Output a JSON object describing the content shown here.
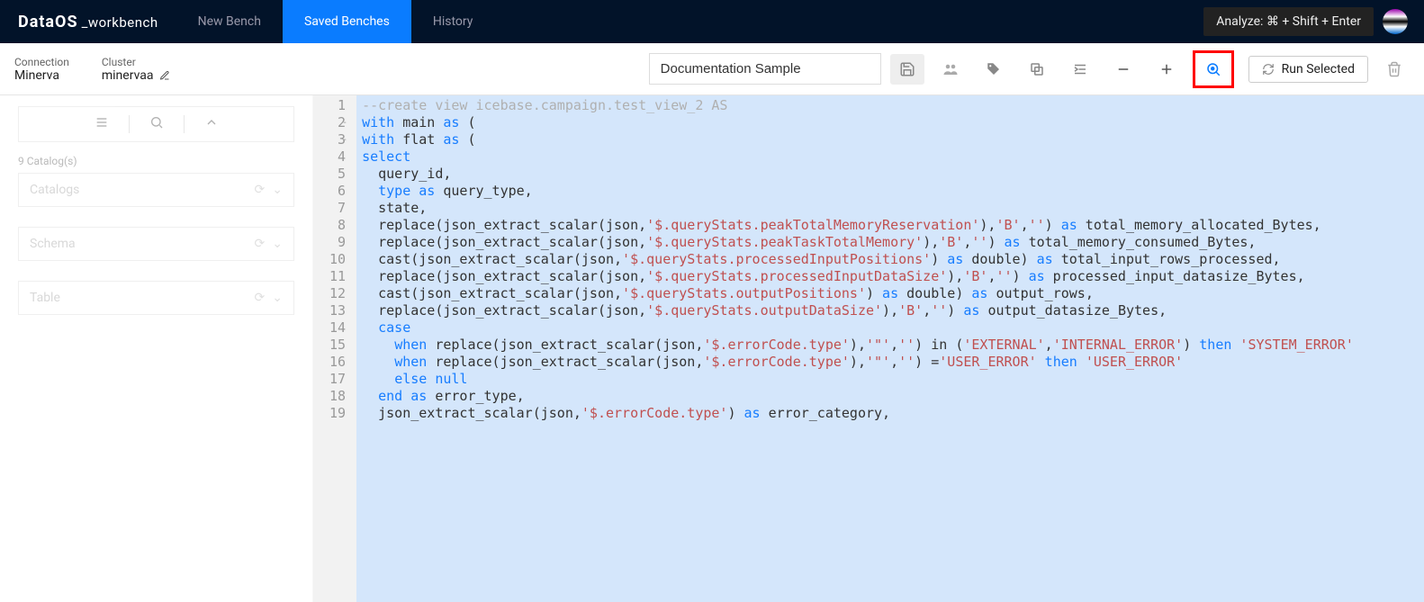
{
  "brand": {
    "logo": "DataOS",
    "sub": "_workbench"
  },
  "tabs": {
    "new": "New Bench",
    "saved": "Saved Benches",
    "history": "History",
    "active": "saved"
  },
  "tooltip": "Analyze: ⌘ + Shift + Enter",
  "connection": {
    "label": "Connection",
    "value": "Minerva"
  },
  "cluster": {
    "label": "Cluster",
    "value": "minervaa"
  },
  "bench_title": "Documentation Sample",
  "toolbar": {
    "run": "Run Selected"
  },
  "sidebar": {
    "catalog_count": "9 Catalog(s)",
    "catalogs_ph": "Catalogs",
    "schema_ph": "Schema",
    "table_ph": "Table"
  },
  "code": {
    "lines": [
      {
        "n": 1,
        "fold": false,
        "tokens": [
          [
            "c-comment",
            "--create view icebase.campaign.test_view_2 AS"
          ]
        ]
      },
      {
        "n": 2,
        "fold": true,
        "tokens": [
          [
            "c-kw",
            "with"
          ],
          [
            "",
            " main "
          ],
          [
            "c-kw",
            "as"
          ],
          [
            "",
            " ("
          ]
        ]
      },
      {
        "n": 3,
        "fold": true,
        "tokens": [
          [
            "c-kw",
            "with"
          ],
          [
            "",
            " flat "
          ],
          [
            "c-kw",
            "as"
          ],
          [
            "",
            " ("
          ]
        ]
      },
      {
        "n": 4,
        "fold": false,
        "tokens": [
          [
            "c-kw",
            "select"
          ]
        ]
      },
      {
        "n": 5,
        "fold": false,
        "tokens": [
          [
            "",
            "  query_id,"
          ]
        ]
      },
      {
        "n": 6,
        "fold": false,
        "tokens": [
          [
            "",
            "  "
          ],
          [
            "c-kw",
            "type"
          ],
          [
            "",
            " "
          ],
          [
            "c-kw",
            "as"
          ],
          [
            "",
            " query_type,"
          ]
        ]
      },
      {
        "n": 7,
        "fold": false,
        "tokens": [
          [
            "",
            "  state,"
          ]
        ]
      },
      {
        "n": 8,
        "fold": false,
        "tokens": [
          [
            "",
            "  replace(json_extract_scalar(json,"
          ],
          [
            "c-str",
            "'$.queryStats.peakTotalMemoryReservation'"
          ],
          [
            "",
            "),"
          ],
          [
            "c-str",
            "'B'"
          ],
          [
            "",
            ","
          ],
          [
            "c-str",
            "''"
          ],
          [
            "",
            ") "
          ],
          [
            "c-kw",
            "as"
          ],
          [
            "",
            " total_memory_allocated_Bytes,"
          ]
        ]
      },
      {
        "n": 9,
        "fold": false,
        "tokens": [
          [
            "",
            "  replace(json_extract_scalar(json,"
          ],
          [
            "c-str",
            "'$.queryStats.peakTaskTotalMemory'"
          ],
          [
            "",
            "),"
          ],
          [
            "c-str",
            "'B'"
          ],
          [
            "",
            ","
          ],
          [
            "c-str",
            "''"
          ],
          [
            "",
            ") "
          ],
          [
            "c-kw",
            "as"
          ],
          [
            "",
            " total_memory_consumed_Bytes,"
          ]
        ]
      },
      {
        "n": 10,
        "fold": false,
        "tokens": [
          [
            "",
            "  cast(json_extract_scalar(json,"
          ],
          [
            "c-str",
            "'$.queryStats.processedInputPositions'"
          ],
          [
            "",
            ") "
          ],
          [
            "c-kw",
            "as"
          ],
          [
            "",
            " double) "
          ],
          [
            "c-kw",
            "as"
          ],
          [
            "",
            " total_input_rows_processed,"
          ]
        ]
      },
      {
        "n": 11,
        "fold": false,
        "tokens": [
          [
            "",
            "  replace(json_extract_scalar(json,"
          ],
          [
            "c-str",
            "'$.queryStats.processedInputDataSize'"
          ],
          [
            "",
            "),"
          ],
          [
            "c-str",
            "'B'"
          ],
          [
            "",
            ","
          ],
          [
            "c-str",
            "''"
          ],
          [
            "",
            ") "
          ],
          [
            "c-kw",
            "as"
          ],
          [
            "",
            " processed_input_datasize_Bytes,"
          ]
        ]
      },
      {
        "n": 12,
        "fold": false,
        "tokens": [
          [
            "",
            "  cast(json_extract_scalar(json,"
          ],
          [
            "c-str",
            "'$.queryStats.outputPositions'"
          ],
          [
            "",
            ") "
          ],
          [
            "c-kw",
            "as"
          ],
          [
            "",
            " double) "
          ],
          [
            "c-kw",
            "as"
          ],
          [
            "",
            " output_rows,"
          ]
        ]
      },
      {
        "n": 13,
        "fold": false,
        "tokens": [
          [
            "",
            "  replace(json_extract_scalar(json,"
          ],
          [
            "c-str",
            "'$.queryStats.outputDataSize'"
          ],
          [
            "",
            "),"
          ],
          [
            "c-str",
            "'B'"
          ],
          [
            "",
            ","
          ],
          [
            "c-str",
            "''"
          ],
          [
            "",
            ") "
          ],
          [
            "c-kw",
            "as"
          ],
          [
            "",
            " output_datasize_Bytes,"
          ]
        ]
      },
      {
        "n": 14,
        "fold": false,
        "tokens": [
          [
            "",
            "  "
          ],
          [
            "c-kw",
            "case"
          ]
        ]
      },
      {
        "n": 15,
        "fold": false,
        "tokens": [
          [
            "",
            "    "
          ],
          [
            "c-kw",
            "when"
          ],
          [
            "",
            " replace(json_extract_scalar(json,"
          ],
          [
            "c-str",
            "'$.errorCode.type'"
          ],
          [
            "",
            "),"
          ],
          [
            "c-str",
            "'\"'"
          ],
          [
            "",
            ","
          ],
          [
            "c-str",
            "''"
          ],
          [
            "",
            ") in ("
          ],
          [
            "c-str",
            "'EXTERNAL'"
          ],
          [
            "",
            ","
          ],
          [
            "c-str",
            "'INTERNAL_ERROR'"
          ],
          [
            "",
            ") "
          ],
          [
            "c-kw",
            "then"
          ],
          [
            "",
            " "
          ],
          [
            "c-str",
            "'SYSTEM_ERROR'"
          ]
        ]
      },
      {
        "n": 16,
        "fold": false,
        "tokens": [
          [
            "",
            "    "
          ],
          [
            "c-kw",
            "when"
          ],
          [
            "",
            " replace(json_extract_scalar(json,"
          ],
          [
            "c-str",
            "'$.errorCode.type'"
          ],
          [
            "",
            "),"
          ],
          [
            "c-str",
            "'\"'"
          ],
          [
            "",
            ","
          ],
          [
            "c-str",
            "''"
          ],
          [
            "",
            ") ="
          ],
          [
            "c-str",
            "'USER_ERROR'"
          ],
          [
            "",
            " "
          ],
          [
            "c-kw",
            "then"
          ],
          [
            "",
            " "
          ],
          [
            "c-str",
            "'USER_ERROR'"
          ]
        ]
      },
      {
        "n": 17,
        "fold": false,
        "tokens": [
          [
            "",
            "    "
          ],
          [
            "c-kw",
            "else"
          ],
          [
            "",
            " "
          ],
          [
            "c-kw",
            "null"
          ]
        ]
      },
      {
        "n": 18,
        "fold": false,
        "tokens": [
          [
            "",
            "  "
          ],
          [
            "c-kw",
            "end"
          ],
          [
            "",
            " "
          ],
          [
            "c-kw",
            "as"
          ],
          [
            "",
            " error_type,"
          ]
        ]
      },
      {
        "n": 19,
        "fold": false,
        "tokens": [
          [
            "",
            "  json_extract_scalar(json,"
          ],
          [
            "c-str",
            "'$.errorCode.type'"
          ],
          [
            "",
            ") "
          ],
          [
            "c-kw",
            "as"
          ],
          [
            "",
            " error_category,"
          ]
        ]
      }
    ]
  }
}
